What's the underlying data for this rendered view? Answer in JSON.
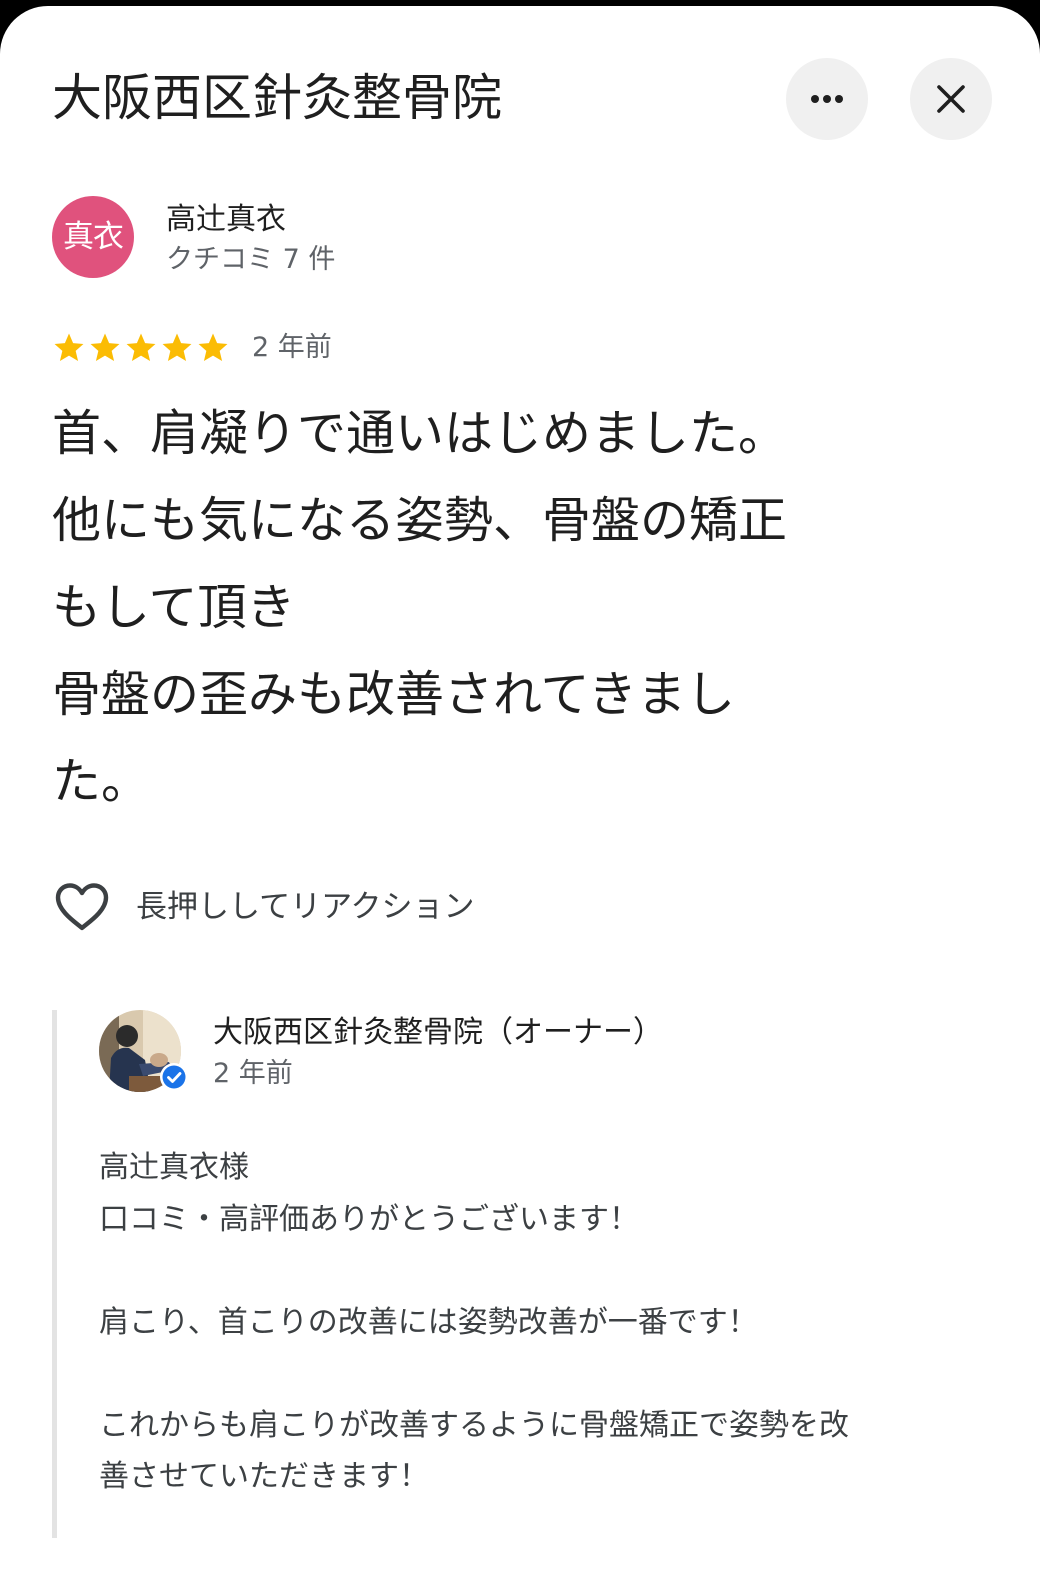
{
  "place": {
    "title": "大阪西区針灸整骨院"
  },
  "header_actions": {
    "more_icon": "more-horizontal-icon",
    "close_icon": "close-icon"
  },
  "review": {
    "avatar_text": "真衣",
    "avatar_color": "#e0527d",
    "author": "高辻真衣",
    "author_meta": "クチコミ 7 件",
    "rating": 5,
    "rating_max": 5,
    "star_color": "#fbbc04",
    "time_ago": "2 年前",
    "text": "首、肩凝りで通いはじめました。\n他にも気になる姿勢、骨盤の矯正\nもして頂き\n骨盤の歪みも改善されてきまし\nた。"
  },
  "reaction": {
    "icon": "heart-outline-icon",
    "label": "長押ししてリアクション"
  },
  "owner_reply": {
    "name": "大阪西区針灸整骨院（オーナー）",
    "time_ago": "2 年前",
    "verified_color": "#1a73e8",
    "text": "高辻真衣様\n口コミ・高評価ありがとうございます！\n\n肩こり、首こりの改善には姿勢改善が一番です！\n\nこれからも肩こりが改善するように骨盤矯正で姿勢を改\n善させていただきます！"
  }
}
